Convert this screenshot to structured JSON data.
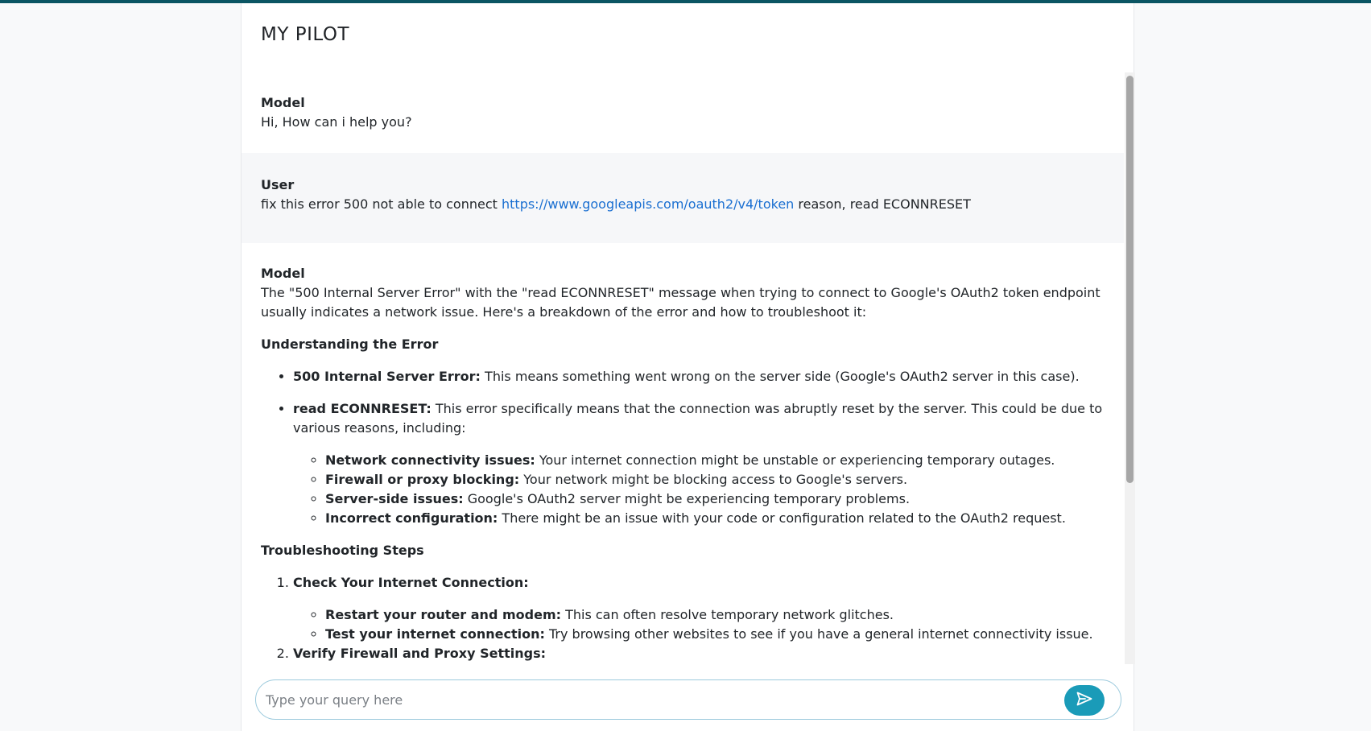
{
  "app": {
    "title": "MY PILOT"
  },
  "messages": {
    "m1": {
      "role": "Model",
      "text": "Hi, How can i help you?"
    },
    "u1": {
      "role": "User",
      "text_before": "fix this error 500 not able to connect ",
      "link": "https://www.googleapis.com/oauth2/v4/token",
      "text_after": " reason, read ECONNRESET"
    },
    "m2": {
      "role": "Model",
      "intro": "The \"500 Internal Server Error\" with the \"read ECONNRESET\" message when trying to connect to Google's OAuth2 token endpoint usually indicates a network issue. Here's a breakdown of the error and how to troubleshoot it:",
      "section1": "Understanding the Error",
      "bullets": [
        {
          "bold": "500 Internal Server Error:",
          "text": " This means something went wrong on the server side (Google's OAuth2 server in this case)."
        },
        {
          "bold": "read ECONNRESET:",
          "text": " This error specifically means that the connection was abruptly reset by the server. This could be due to various reasons, including:"
        }
      ],
      "reasons": [
        {
          "bold": "Network connectivity issues:",
          "text": " Your internet connection might be unstable or experiencing temporary outages."
        },
        {
          "bold": "Firewall or proxy blocking:",
          "text": " Your network might be blocking access to Google's servers."
        },
        {
          "bold": "Server-side issues:",
          "text": " Google's OAuth2 server might be experiencing temporary problems."
        },
        {
          "bold": "Incorrect configuration:",
          "text": " There might be an issue with your code or configuration related to the OAuth2 request."
        }
      ],
      "section2": "Troubleshooting Steps",
      "steps": [
        {
          "title": "Check Your Internet Connection:",
          "items": [
            {
              "bold": "Restart your router and modem:",
              "text": " This can often resolve temporary network glitches."
            },
            {
              "bold": "Test your internet connection:",
              "text": " Try browsing other websites to see if you have a general internet connectivity issue."
            }
          ]
        },
        {
          "title": "Verify Firewall and Proxy Settings:"
        }
      ]
    }
  },
  "input": {
    "placeholder": "Type your query here",
    "value": ""
  },
  "icons": {
    "send": "send-icon"
  },
  "colors": {
    "accent": "#1a9bb8",
    "topbar": "#0b5563",
    "link": "#1a6fd1"
  }
}
